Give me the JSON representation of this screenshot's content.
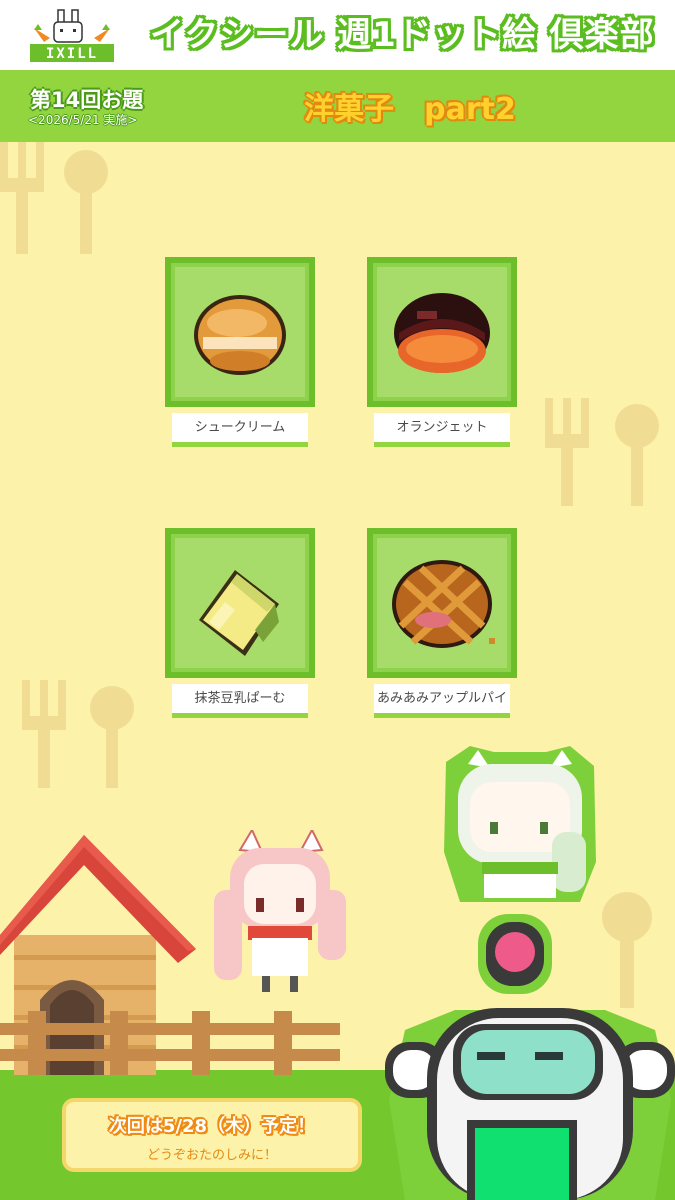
{
  "header": {
    "logo_text": "IXILL",
    "site_title": "イクシール 週1ドット絵 倶楽部"
  },
  "round": {
    "number_label": "第14回お題",
    "date": "<2026/5/21 実施>"
  },
  "theme": {
    "title": "洋菓子　part2"
  },
  "items": [
    {
      "name": "シュークリーム",
      "icon": "cream-puff-icon"
    },
    {
      "name": "オランジェット",
      "icon": "orangette-icon"
    },
    {
      "name": "抹茶豆乳ぱーむ",
      "icon": "matcha-soy-cake-icon"
    },
    {
      "name": "あみあみアップルパイ",
      "icon": "lattice-apple-pie-icon"
    }
  ],
  "notice": {
    "main": "次回は5/28（木）予定！",
    "sub": "どうぞおたのしみに！"
  },
  "colors": {
    "background": "#fdf2a9",
    "accent_green": "#93d53f",
    "tile_green": "#8ed14a",
    "orange_text": "#f08a12"
  }
}
